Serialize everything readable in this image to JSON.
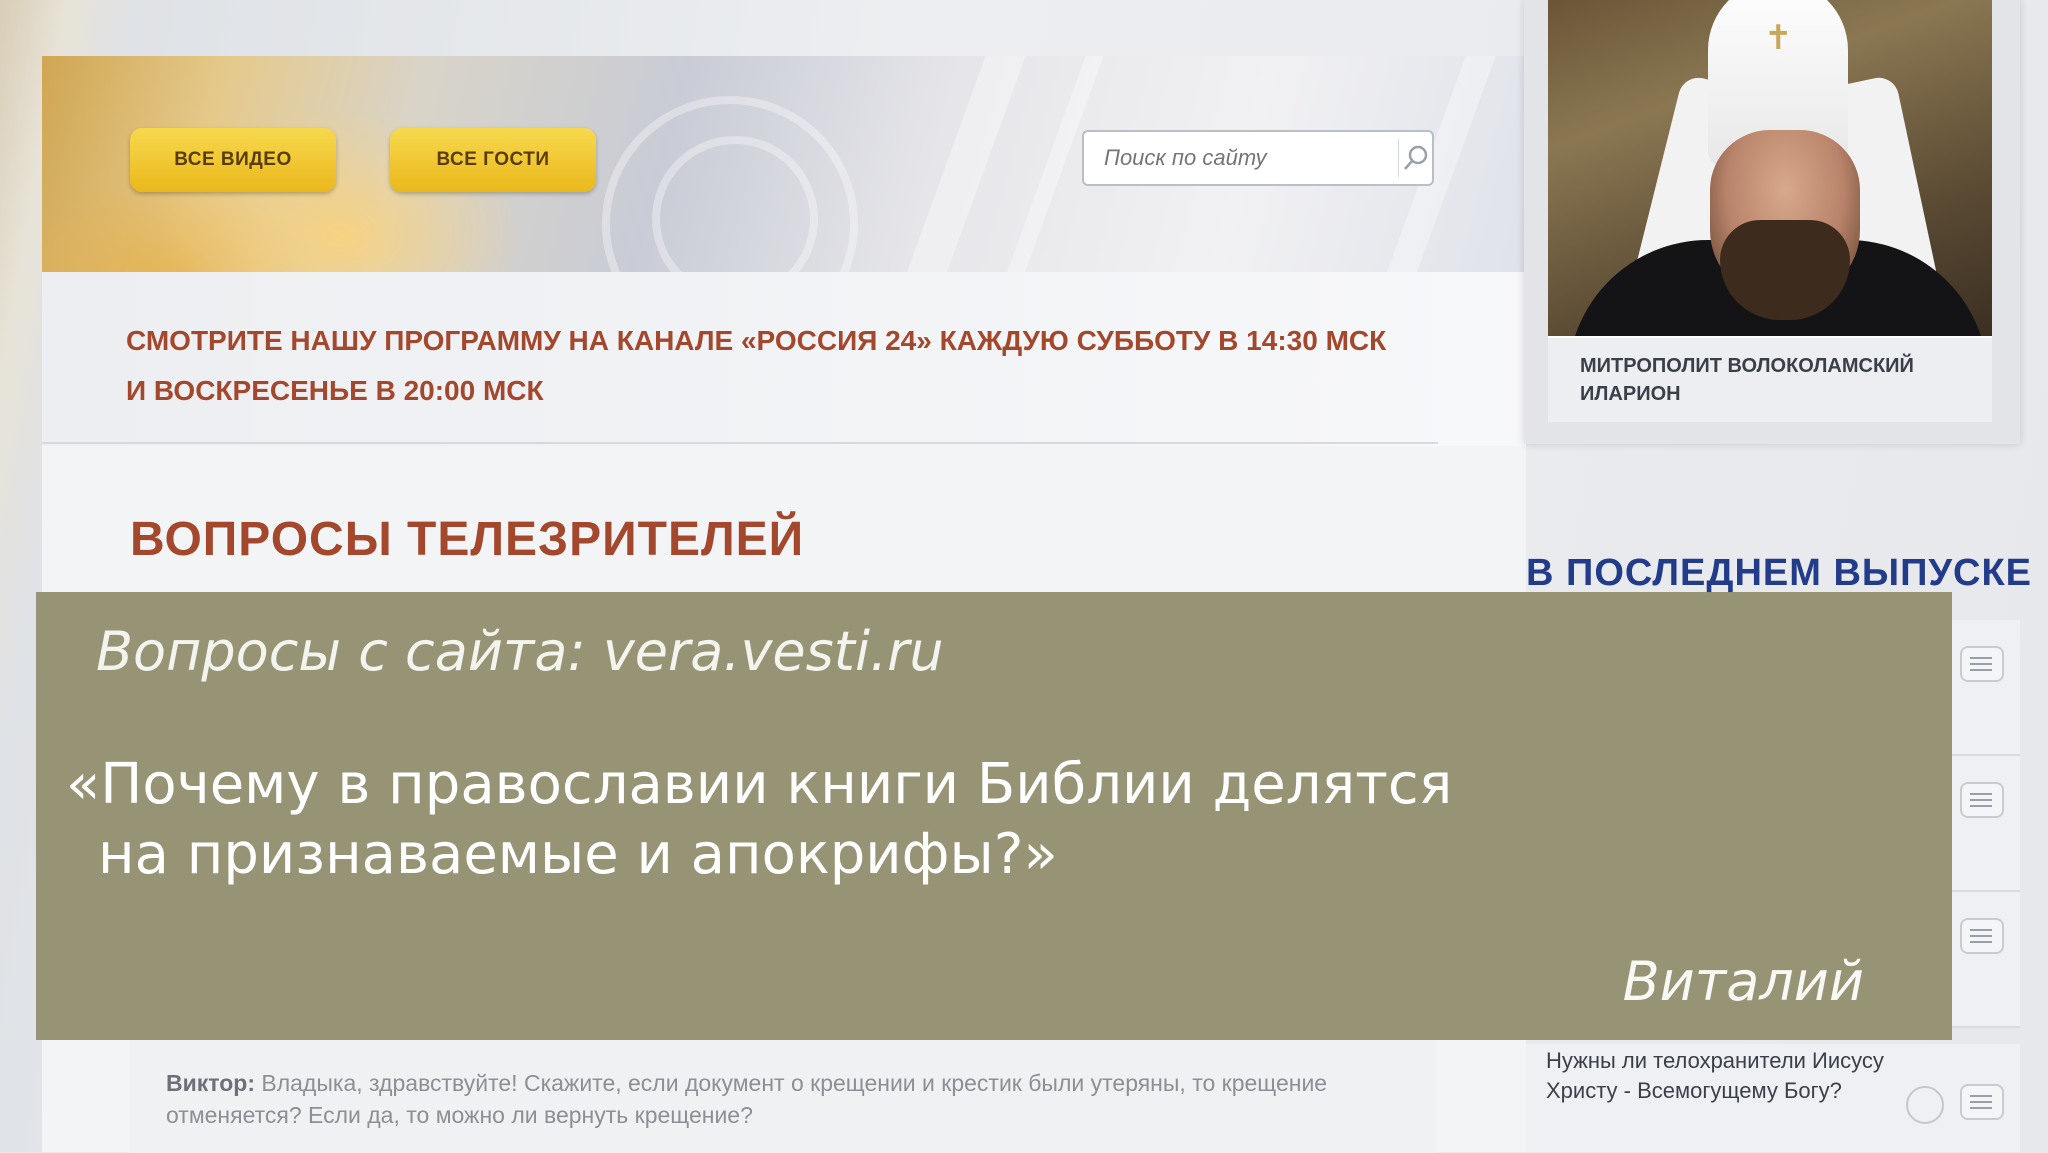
{
  "header": {
    "buttons": [
      "ВСЕ ВИДЕО",
      "ВСЕ ГОСТИ"
    ],
    "search": {
      "placeholder": "Поиск по сайту"
    }
  },
  "info": {
    "schedule_line1": "СМОТРИТЕ НАШУ ПРОГРАММУ НА КАНАЛЕ «РОССИЯ 24» КАЖДУЮ СУББОТУ В 14:30 МСК",
    "schedule_line2": "И ВОСКРЕСЕНЬЕ В 20:00 МСК"
  },
  "main": {
    "section_title": "ВОПРОСЫ ТЕЛЕЗРИТЕЛЕЙ",
    "comment": {
      "author": "Виктор:",
      "text": "Владыка, здравствуйте! Скажите, если документ о крещении и крестик были утеряны, то крещение отменяется? Если да, то можно ли вернуть крещение?"
    }
  },
  "sidebar": {
    "guest": {
      "caption_line1": "МИТРОПОЛИТ ВОЛОКОЛАМСКИЙ",
      "caption_line2": "ИЛАРИОН"
    },
    "latest_title": "В ПОСЛЕДНЕМ ВЫПУСКЕ",
    "items": [
      {
        "title": ""
      },
      {
        "title": ""
      },
      {
        "title": ""
      },
      {
        "title": "Нужны ли телохранители Иисусу Христу - Всемогущему Богу?"
      }
    ]
  },
  "overlay": {
    "source": "Вопросы с сайта: vera.vesti.ru",
    "question_line1": "«Почему в православии книги Библии делятся",
    "question_line2": "на признаваемые и апокрифы?»",
    "author": "Виталий"
  },
  "colors": {
    "accent_red": "#a3472d",
    "accent_blue": "#233c8a",
    "button_yellow": "#eab81b",
    "overlay_olive": "#949172"
  },
  "icons": [
    "search-icon",
    "list-icon",
    "play-icon"
  ]
}
